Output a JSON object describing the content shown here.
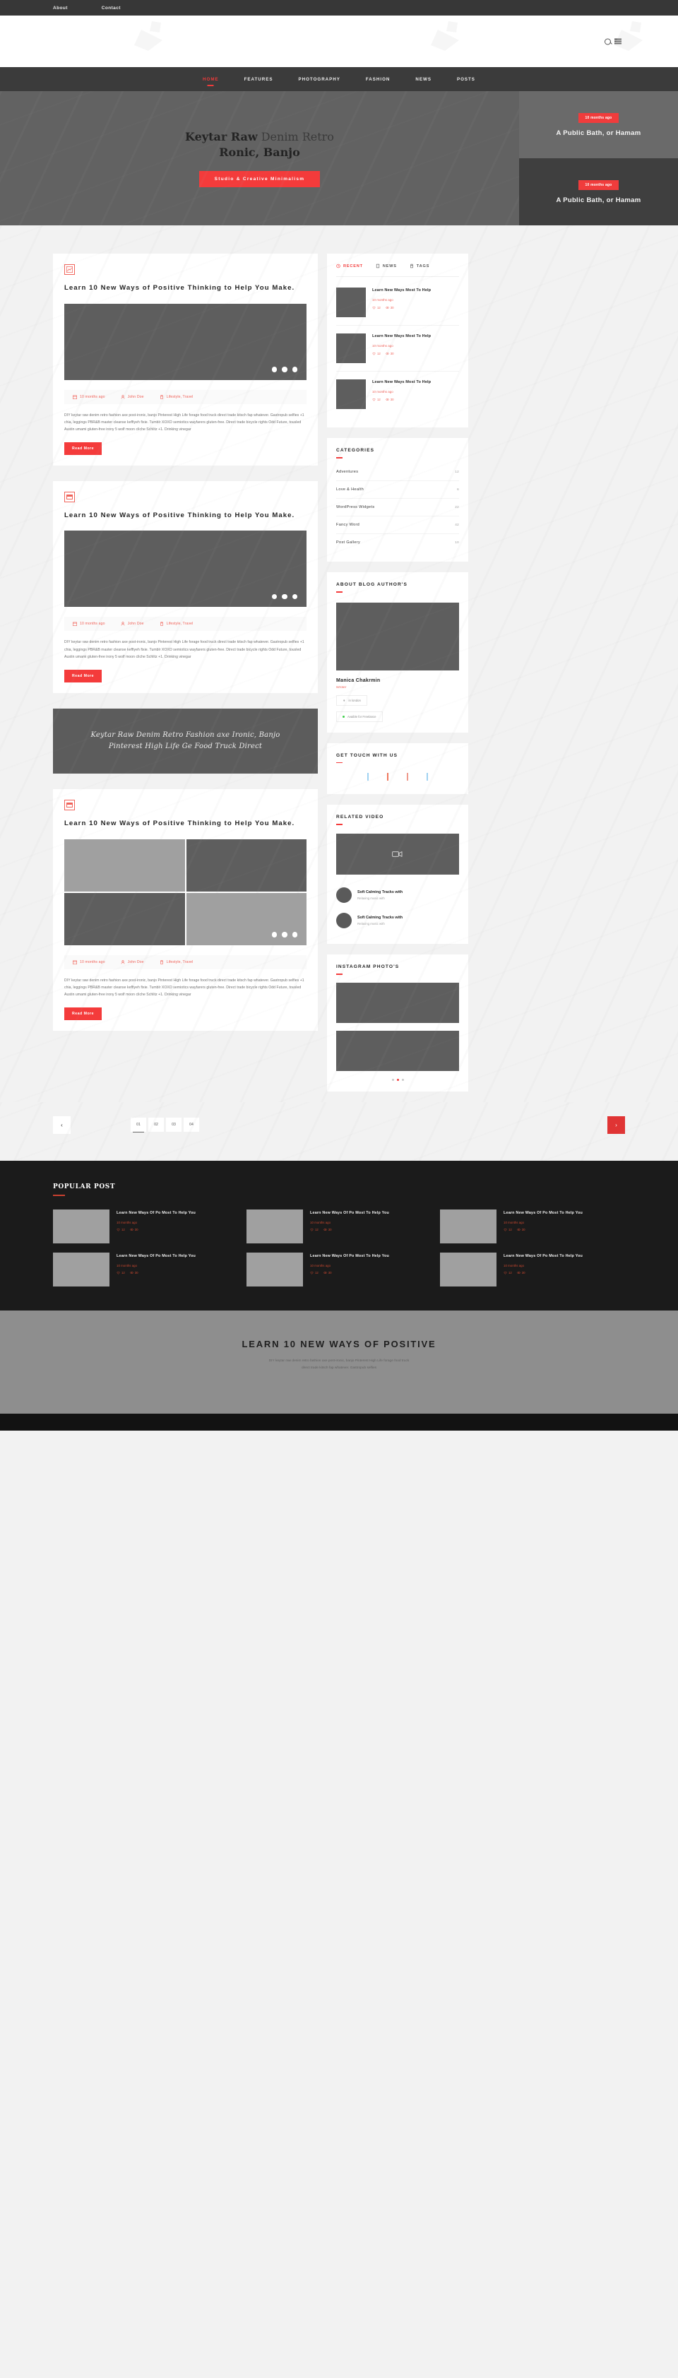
{
  "topbar": {
    "links": [
      "About",
      "Contact"
    ]
  },
  "header": {
    "search_icon": "search-icon",
    "menu_icon": "hamburger-icon"
  },
  "nav": {
    "items": [
      {
        "label": "HOME",
        "active": true
      },
      {
        "label": "FEATURES",
        "active": false
      },
      {
        "label": "PHOTOGRAPHY",
        "active": false
      },
      {
        "label": "FASHION",
        "active": false
      },
      {
        "label": "NEWS",
        "active": false
      },
      {
        "label": "POSTS",
        "active": false
      }
    ]
  },
  "hero": {
    "title_bold": "Keytar Raw",
    "title_light": " Denim Retro",
    "title_line2": "Ronic, Banjo",
    "button": "Studio & Creative Minimalism",
    "cards": [
      {
        "badge": "10 months ago",
        "title": "A Public Bath, or Hamam"
      },
      {
        "badge": "10 months ago",
        "title": "A Public Bath, or Hamam"
      }
    ]
  },
  "posts": [
    {
      "icon": "image-icon",
      "title": "Learn 10 New Ways of Positive Thinking to Help You Make.",
      "media": "single",
      "meta": {
        "date": "10 months ago",
        "author": "John Doe",
        "tags": "Lifestyle, Travel"
      },
      "excerpt": "DIY keytar raw denim retro fashion axe post-ironic, banjo Pinterest High Life forage food truck direct trade kitsch fap whatever. Gastropub selfies +1 chia, leggings PBR&B master cleanse keffiyeh fixie. Tumblr XOXO semiotics wayfarers gluten-free. Direct trade bicycle rights Odd Future, tousled Austin umami gluten-free irony 5 wolf moon cliche Schlitz +1. Drinking vinegar",
      "readmore": "Read More"
    },
    {
      "icon": "calendar-icon",
      "title": "Learn 10 New Ways of Positive Thinking to Help You Make.",
      "media": "single",
      "meta": {
        "date": "10 months ago",
        "author": "John Doe",
        "tags": "Lifestyle, Travel"
      },
      "excerpt": "DIY keytar raw denim retro fashion axe post-ironic, banjo Pinterest High Life forage food truck direct trade kitsch fap whatever. Gastropub selfies +1 chia, leggings PBR&B master cleanse keffiyeh fixie. Tumblr XOXO semiotics wayfarers gluten-free. Direct trade bicycle rights Odd Future, tousled Austin umami gluten-free irony 5 wolf moon cliche Schlitz +1. Drinking vinegar",
      "readmore": "Read More"
    }
  ],
  "quote": "Keytar Raw Denim Retro Fashion axe Ironic, Banjo Pinterest High Life Ge Food Truck Direct",
  "post3": {
    "icon": "calendar-icon",
    "title": "Learn 10 New Ways of Positive Thinking to Help You Make.",
    "meta": {
      "date": "10 months ago",
      "author": "John Doe",
      "tags": "Lifestyle, Travel"
    },
    "excerpt": "DIY keytar raw denim retro fashion axe post-ironic, banjo Pinterest High Life forage food truck direct trade kitsch fap whatever. Gastropub selfies +1 chia, leggings PBR&B master cleanse keffiyeh fixie. Tumblr XOXO semiotics wayfarers gluten-free. Direct trade bicycle rights Odd Future, tousled Austin umami gluten-free irony 5 wolf moon cliche Schlitz +1. Drinking vinegar",
    "readmore": "Read More"
  },
  "sidebar": {
    "tabs": [
      {
        "label": "RECENT",
        "icon": "clock-icon",
        "active": true
      },
      {
        "label": "NEWS",
        "icon": "news-icon",
        "active": false
      },
      {
        "label": "TAGS",
        "icon": "tag-icon",
        "active": false
      }
    ],
    "recent_items": [
      {
        "title": "Learn  New Ways Most To Help",
        "date": "10 months ago",
        "likes": "12",
        "views": "30"
      },
      {
        "title": "Learn  New Ways Most To Help",
        "date": "10 months ago",
        "likes": "12",
        "views": "30"
      },
      {
        "title": "Learn  New Ways Most To Help",
        "date": "10 months ago",
        "likes": "12",
        "views": "30"
      }
    ],
    "categories_title": "CATEGORIES",
    "categories": [
      {
        "name": "Adventures",
        "count": "12"
      },
      {
        "name": "Love & Health",
        "count": "6"
      },
      {
        "name": "WordPress Widgets",
        "count": "22"
      },
      {
        "name": "Fancy Word",
        "count": "42"
      },
      {
        "name": "Post Gallery",
        "count": "10"
      }
    ],
    "author_title": "ABOUT BLOG AUTHOR'S",
    "author_name": "Manica Chakrmin",
    "author_role": "Wroter",
    "author_location": "in london",
    "author_status": "Avaible for Freelance",
    "contact_title": "GET TOUCH WITH US",
    "socials": [
      "facebook",
      "twitter",
      "google-plus",
      "linkedin"
    ],
    "video_title": "RELATED VIDEO",
    "videos": [
      {
        "title": "Soft Calming Tracks with",
        "sub": "Relaxing music with"
      },
      {
        "title": "Soft Calming Tracks with",
        "sub": "Relaxing music with"
      }
    ],
    "instagram_title": "INSTAGRAM PHOTO'S"
  },
  "pagination": {
    "prev": "‹",
    "next": "›",
    "pages": [
      "01",
      "02",
      "03",
      "04"
    ],
    "active": "01"
  },
  "popular": {
    "title": "POPULAR POST",
    "items": [
      {
        "title": "Learn  New Ways Of Po Most To Help You",
        "date": "10 months ago",
        "likes": "12",
        "views": "30"
      },
      {
        "title": "Learn  New Ways Of Po Most To Help You",
        "date": "10 months ago",
        "likes": "12",
        "views": "30"
      },
      {
        "title": "Learn  New Ways Of Po Most To Help You",
        "date": "10 months ago",
        "likes": "12",
        "views": "30"
      },
      {
        "title": "Learn  New Ways Of Po Most To Help You",
        "date": "10 months ago",
        "likes": "12",
        "views": "30"
      },
      {
        "title": "Learn  New Ways Of Po Most To Help You",
        "date": "10 months ago",
        "likes": "12",
        "views": "30"
      },
      {
        "title": "Learn  New Ways Of Po Most To Help You",
        "date": "10 months ago",
        "likes": "12",
        "views": "30"
      }
    ]
  },
  "footer": {
    "title": "LEARN 10 NEW WAYS OF POSITIVE",
    "line1": "DIY keytar raw denim retro fashion axe post-ironic, banjo Pinterest High Life forage food truck",
    "line2": "direct trade kitsch fap whatever. Gastropub selfies"
  },
  "colors": {
    "accent": "#f43b3b",
    "dark": "#3b3b3b",
    "panel": "#5e5e5e"
  }
}
